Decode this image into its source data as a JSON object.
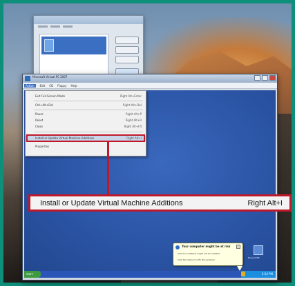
{
  "colors": {
    "frame_border": "#0e8f79",
    "callout_border": "#c0182b",
    "guest_desktop": "#2d57a8"
  },
  "vm_window": {
    "title": "Microsoft Virtual PC 2007",
    "menu": [
      "Action",
      "Edit",
      "CD",
      "Floppy",
      "Help"
    ]
  },
  "action_menu": {
    "items": [
      {
        "label": "Exit Full-Screen Mode",
        "shortcut": "Right Alt+Enter"
      },
      {
        "label": "Ctrl+Alt+Del",
        "shortcut": "Right Alt+Del"
      },
      {
        "label": "Pause",
        "shortcut": "Right Alt+P"
      },
      {
        "label": "Reset",
        "shortcut": "Right Alt+R"
      },
      {
        "label": "Close",
        "shortcut": "Right Alt+F4"
      },
      {
        "label": "Install or Update Virtual Machine Additions",
        "shortcut": "Right Alt+I"
      },
      {
        "label": "Properties",
        "shortcut": ""
      }
    ]
  },
  "callout": {
    "label": "Install or Update Virtual Machine Additions",
    "shortcut": "Right Alt+I"
  },
  "guest": {
    "desktop_icon_label": "Recycle Bin",
    "taskbar_start": "start",
    "clock": "2:54 PM",
    "balloon_title": "Your computer might be at risk",
    "balloon_line1": "Antivirus software might not be installed",
    "balloon_line2": "Click this balloon to fix this problem."
  },
  "icons": [
    "vm-icon",
    "info-icon",
    "close-icon",
    "recycle-bin-icon",
    "shield-icon",
    "minimize-icon",
    "maximize-icon"
  ]
}
